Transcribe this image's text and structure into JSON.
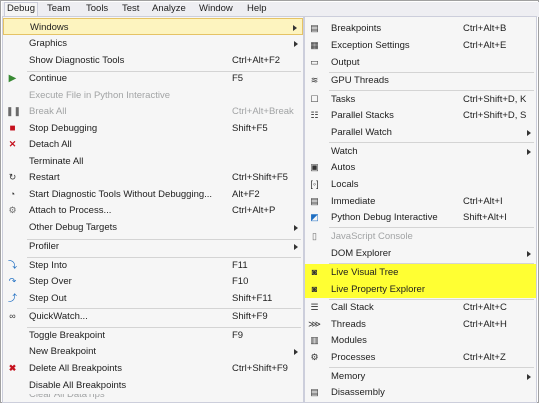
{
  "menubar": {
    "items": [
      "Debug",
      "Team",
      "Tools",
      "Test",
      "Analyze",
      "Window",
      "Help"
    ]
  },
  "debug_menu": {
    "items": [
      {
        "label": "Windows",
        "shortcut": ""
      },
      {
        "label": "Graphics",
        "shortcut": ""
      },
      {
        "label": "Show Diagnostic Tools",
        "shortcut": "Ctrl+Alt+F2"
      },
      {
        "label": "Continue",
        "shortcut": "F5"
      },
      {
        "label": "Execute File in Python Interactive",
        "shortcut": ""
      },
      {
        "label": "Break All",
        "shortcut": "Ctrl+Alt+Break"
      },
      {
        "label": "Stop Debugging",
        "shortcut": "Shift+F5"
      },
      {
        "label": "Detach All",
        "shortcut": ""
      },
      {
        "label": "Terminate All",
        "shortcut": ""
      },
      {
        "label": "Restart",
        "shortcut": "Ctrl+Shift+F5"
      },
      {
        "label": "Start Diagnostic Tools Without Debugging...",
        "shortcut": "Alt+F2"
      },
      {
        "label": "Attach to Process...",
        "shortcut": "Ctrl+Alt+P"
      },
      {
        "label": "Other Debug Targets",
        "shortcut": ""
      },
      {
        "label": "Profiler",
        "shortcut": ""
      },
      {
        "label": "Step Into",
        "shortcut": "F11"
      },
      {
        "label": "Step Over",
        "shortcut": "F10"
      },
      {
        "label": "Step Out",
        "shortcut": "Shift+F11"
      },
      {
        "label": "QuickWatch...",
        "shortcut": "Shift+F9"
      },
      {
        "label": "Toggle Breakpoint",
        "shortcut": "F9"
      },
      {
        "label": "New Breakpoint",
        "shortcut": ""
      },
      {
        "label": "Delete All Breakpoints",
        "shortcut": "Ctrl+Shift+F9"
      },
      {
        "label": "Disable All Breakpoints",
        "shortcut": ""
      },
      {
        "label": "Clear All DataTips",
        "shortcut": ""
      }
    ]
  },
  "windows_menu": {
    "items": [
      {
        "label": "Breakpoints",
        "shortcut": "Ctrl+Alt+B"
      },
      {
        "label": "Exception Settings",
        "shortcut": "Ctrl+Alt+E"
      },
      {
        "label": "Output",
        "shortcut": ""
      },
      {
        "label": "GPU Threads",
        "shortcut": ""
      },
      {
        "label": "Tasks",
        "shortcut": "Ctrl+Shift+D, K"
      },
      {
        "label": "Parallel Stacks",
        "shortcut": "Ctrl+Shift+D, S"
      },
      {
        "label": "Parallel Watch",
        "shortcut": ""
      },
      {
        "label": "Watch",
        "shortcut": ""
      },
      {
        "label": "Autos",
        "shortcut": ""
      },
      {
        "label": "Locals",
        "shortcut": ""
      },
      {
        "label": "Immediate",
        "shortcut": "Ctrl+Alt+I"
      },
      {
        "label": "Python Debug Interactive",
        "shortcut": "Shift+Alt+I"
      },
      {
        "label": "JavaScript Console",
        "shortcut": ""
      },
      {
        "label": "DOM Explorer",
        "shortcut": ""
      },
      {
        "label": "Live Visual Tree",
        "shortcut": ""
      },
      {
        "label": "Live Property Explorer",
        "shortcut": ""
      },
      {
        "label": "Call Stack",
        "shortcut": "Ctrl+Alt+C"
      },
      {
        "label": "Threads",
        "shortcut": "Ctrl+Alt+H"
      },
      {
        "label": "Modules",
        "shortcut": ""
      },
      {
        "label": "Processes",
        "shortcut": "Ctrl+Alt+Z"
      },
      {
        "label": "Memory",
        "shortcut": ""
      },
      {
        "label": "Disassembly",
        "shortcut": ""
      }
    ]
  },
  "colors": {
    "highlight": "#ffff33",
    "hover_background": "#fdf4bf",
    "menu_background": "#f6f6f6",
    "disabled_text": "#a2a4a5"
  }
}
